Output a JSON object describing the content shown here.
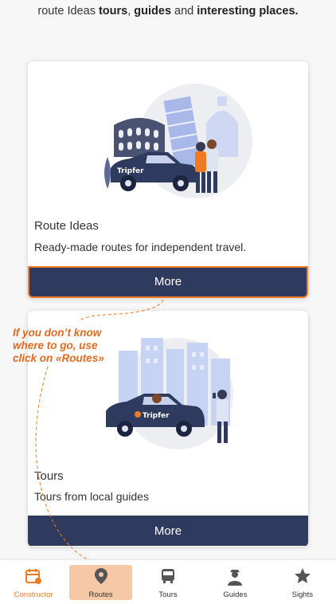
{
  "intro": {
    "prefix": "route Ideas ",
    "bold1": "tours",
    "sep": ", ",
    "bold2": "guides",
    "mid": " and ",
    "bold3": "interesting places."
  },
  "cards": [
    {
      "title": "Route Ideas",
      "description": "Ready-made routes for independent travel.",
      "button": "More"
    },
    {
      "title": "Tours",
      "description": "Tours from local guides",
      "button": "More"
    }
  ],
  "hint": "If you don’t know where to go, use click on «Routes»",
  "tabs": [
    {
      "label": "Constructor",
      "icon": "calendar-check-icon"
    },
    {
      "label": "Routes",
      "icon": "map-pin-icon"
    },
    {
      "label": "Tours",
      "icon": "bus-icon"
    },
    {
      "label": "Guides",
      "icon": "guide-person-icon"
    },
    {
      "label": "Sights",
      "icon": "star-icon"
    }
  ],
  "colors": {
    "accent": "#f07a22",
    "button": "#2e3a5e",
    "highlight": "#f7c8a6"
  },
  "brand": "Tripfer"
}
